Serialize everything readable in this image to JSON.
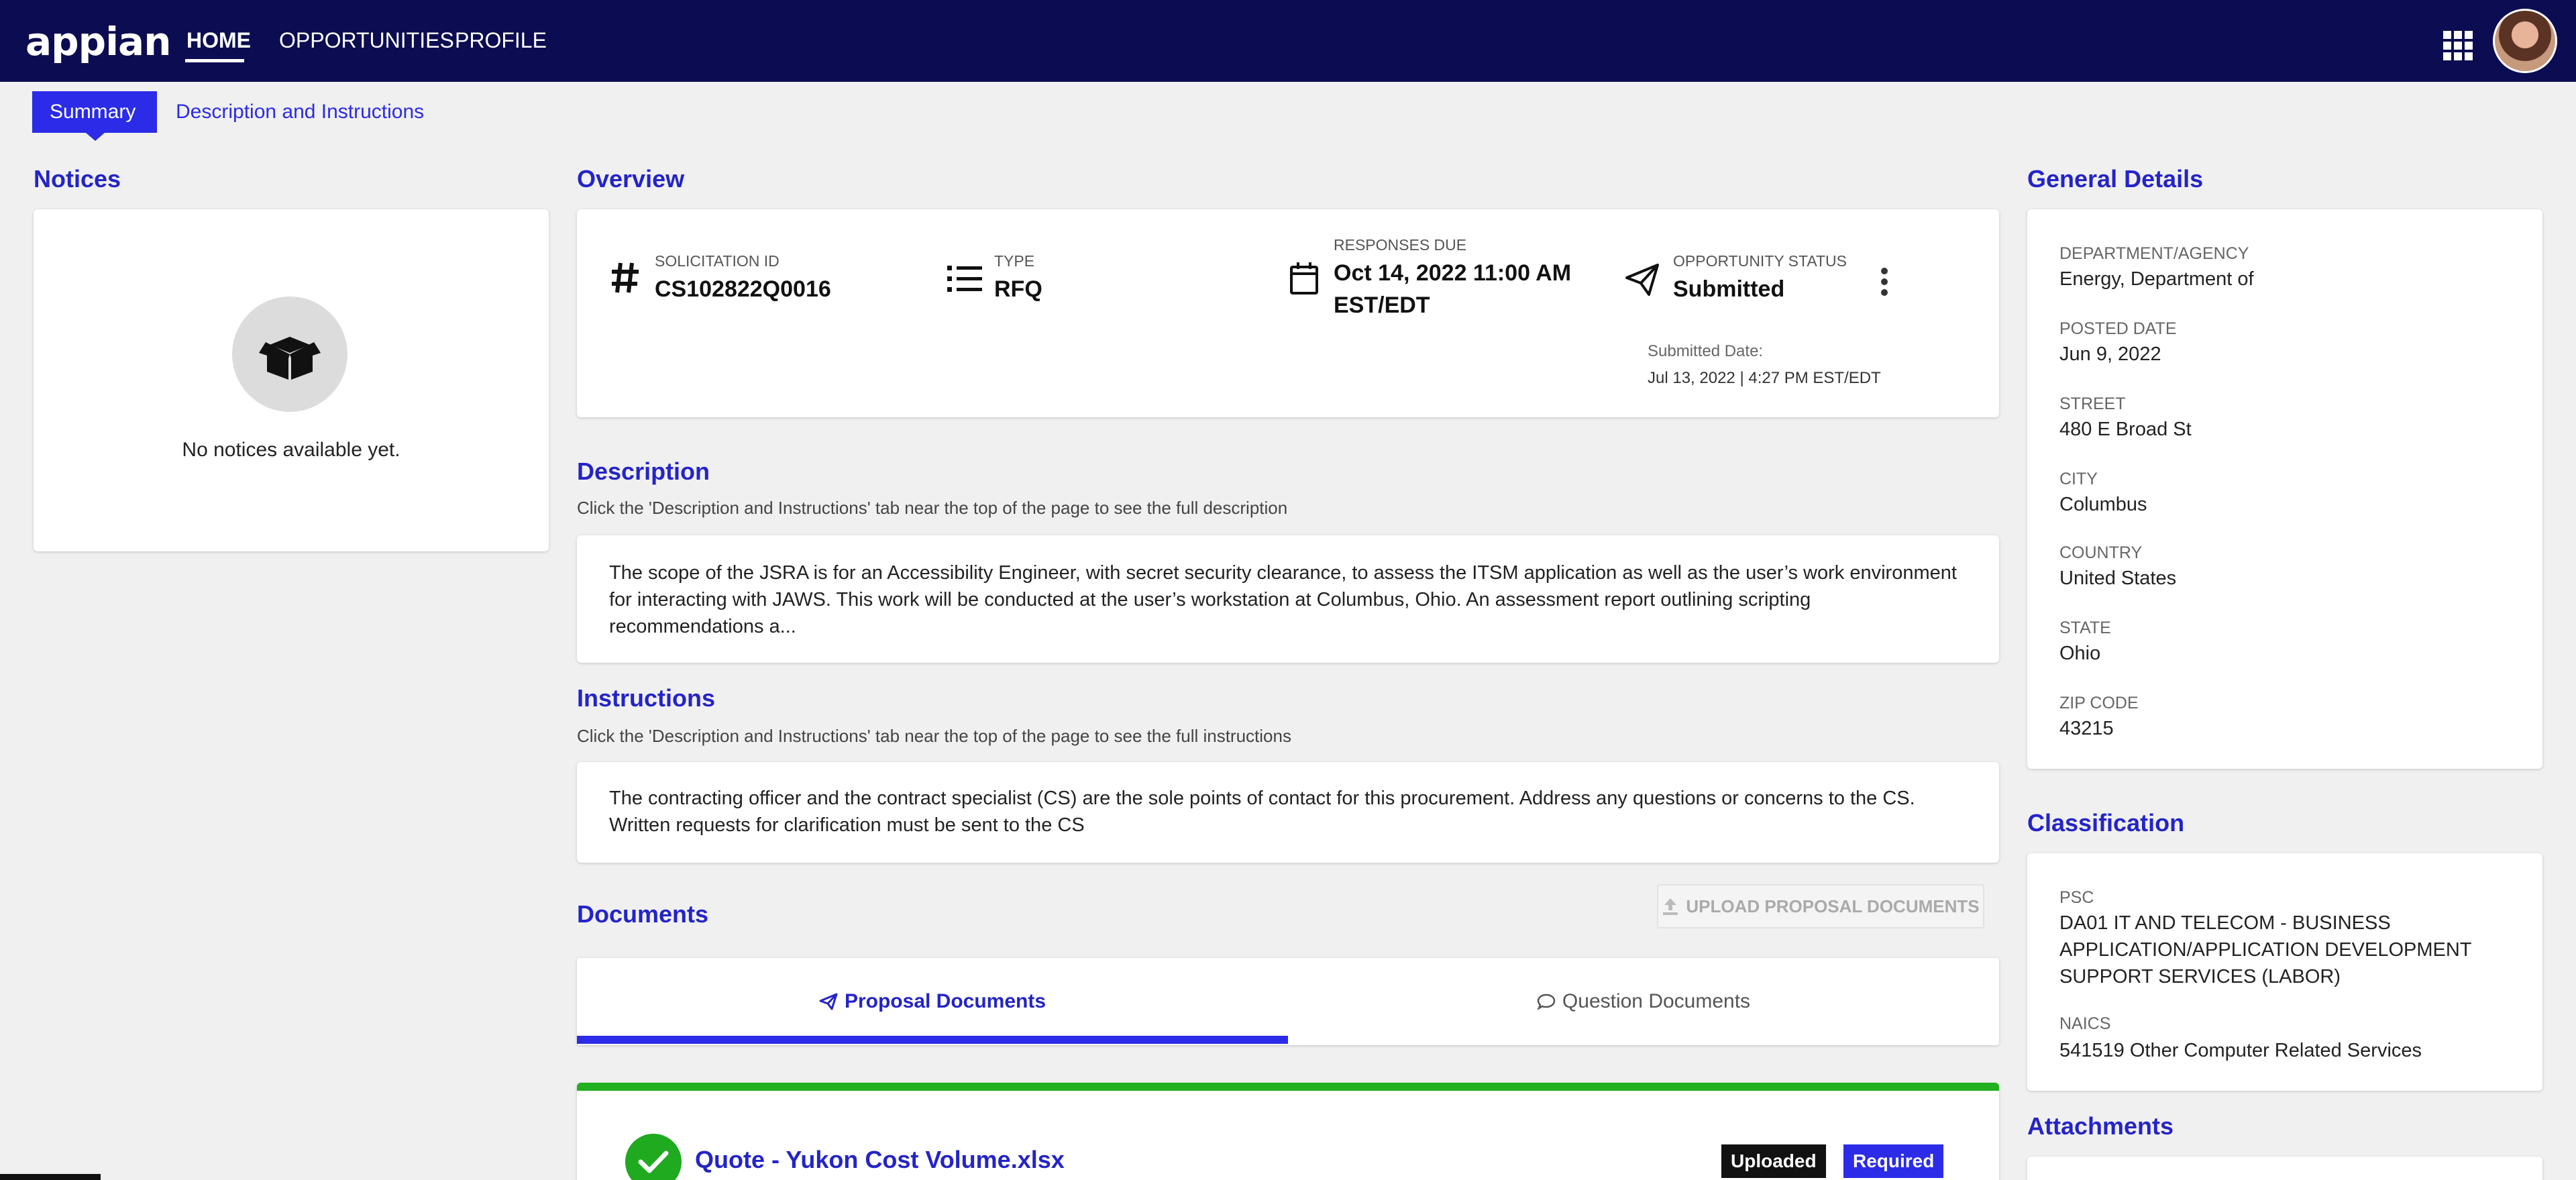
{
  "header": {
    "logo": "appian",
    "nav": [
      {
        "label": "HOME",
        "active": true
      },
      {
        "label": "OPPORTUNITIES",
        "active": false
      },
      {
        "label": "PROFILE",
        "active": false
      }
    ],
    "apps_icon": "grid-icon",
    "avatar_icon": "user-avatar"
  },
  "tabs": [
    {
      "label": "Summary",
      "selected": true
    },
    {
      "label": "Description and Instructions",
      "selected": false
    }
  ],
  "notices": {
    "title": "Notices",
    "icon": "box-icon",
    "empty_text": "No notices available yet."
  },
  "overview": {
    "title": "Overview",
    "solicitation_id": {
      "label": "SOLICITATION ID",
      "value": "CS102822Q0016",
      "icon": "hash-icon"
    },
    "type": {
      "label": "TYPE",
      "value": "RFQ",
      "icon": "list-icon"
    },
    "responses_due": {
      "label": "RESPONSES DUE",
      "value_line1": "Oct 14, 2022 11:00 AM",
      "value_line2": "EST/EDT",
      "icon": "calendar-icon"
    },
    "status": {
      "label": "OPPORTUNITY STATUS",
      "value": "Submitted",
      "icon": "paper-plane-icon"
    },
    "submitted_date_label": "Submitted Date:",
    "submitted_date_value": "Jul 13, 2022 | 4:27 PM EST/EDT",
    "more_icon": "more-vertical-icon"
  },
  "description": {
    "title": "Description",
    "hint": "Click the 'Description and Instructions' tab near the top of the page to see the full description",
    "lines": [
      "The scope of the JSRA is for an Accessibility Engineer, with secret security clearance, to assess the ITSM application as well as the user’s work environment",
      "for interacting with JAWS. This work will be conducted at the user’s workstation at Columbus, Ohio. An assessment report outlining scripting",
      "recommendations a..."
    ]
  },
  "instructions": {
    "title": "Instructions",
    "hint": "Click the 'Description and Instructions' tab near the top of the page to see the full instructions",
    "lines": [
      "The contracting officer and the contract specialist (CS) are the sole points of contact for this procurement. Address any questions or concerns to the CS.",
      "Written requests for clarification must be sent to the CS"
    ]
  },
  "documents": {
    "title": "Documents",
    "upload_label": "UPLOAD PROPOSAL DOCUMENTS",
    "upload_icon": "upload-icon",
    "tabs": [
      {
        "label": "Proposal Documents",
        "icon": "paper-plane-icon",
        "active": true
      },
      {
        "label": "Question Documents",
        "icon": "speech-bubble-icon",
        "active": false
      }
    ],
    "items": [
      {
        "name": "Quote - Yukon Cost Volume.xlsx",
        "status": "Uploaded",
        "requirement": "Required",
        "icon": "check-circle-icon"
      }
    ],
    "accent_green": "#1faa1f"
  },
  "general_details": {
    "title": "General Details",
    "fields": [
      {
        "label": "DEPARTMENT/AGENCY",
        "value": "Energy, Department of"
      },
      {
        "label": "POSTED DATE",
        "value": "Jun 9, 2022"
      },
      {
        "label": "STREET",
        "value": "480 E Broad St"
      },
      {
        "label": "CITY",
        "value": "Columbus"
      },
      {
        "label": "COUNTRY",
        "value": "United States"
      },
      {
        "label": "STATE",
        "value": "Ohio"
      },
      {
        "label": "ZIP CODE",
        "value": "43215"
      }
    ]
  },
  "classification": {
    "title": "Classification",
    "psc_label": "PSC",
    "psc_lines": [
      "DA01 IT AND TELECOM - BUSINESS",
      "APPLICATION/APPLICATION DEVELOPMENT",
      "SUPPORT SERVICES (LABOR)"
    ],
    "naics_label": "NAICS",
    "naics_value": "541519 Other Computer Related Services"
  },
  "attachments": {
    "title": "Attachments"
  },
  "colors": {
    "header_bg": "#0c0c52",
    "accent": "#2b2be8",
    "heading": "#2424c8"
  }
}
